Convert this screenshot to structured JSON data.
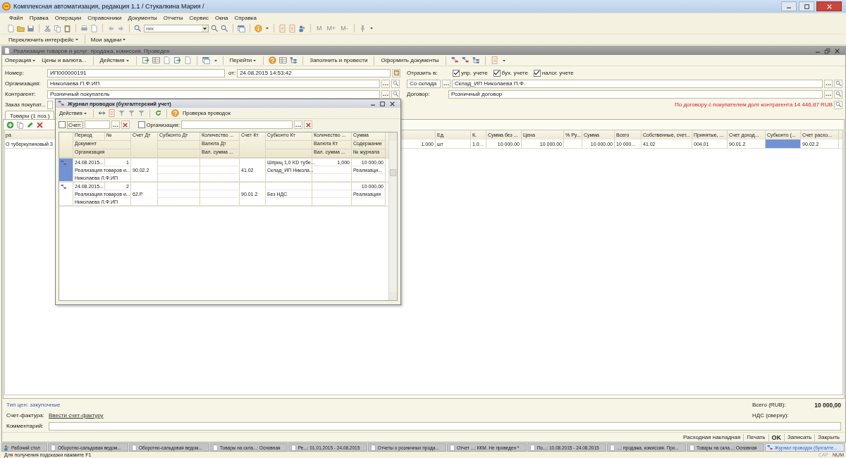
{
  "app_window": {
    "title": "Комплексная автоматизация, редакция 1.1 / Стукалкина Мария /"
  },
  "menu": [
    "Файл",
    "Правка",
    "Операции",
    "Справочники",
    "Документы",
    "Отчеты",
    "Сервис",
    "Окна",
    "Справка"
  ],
  "toolbar": {
    "search_value": "ник",
    "memory_buttons": [
      "M",
      "M+",
      "M-"
    ]
  },
  "panel": [
    {
      "label": "Переключить интерфейс",
      "dropdown": true
    },
    {
      "label": "Мои задачи",
      "dropdown": true
    }
  ],
  "document": {
    "title": "Реализация товаров и услуг: продажа, комиссия. Проведен",
    "toolbar": [
      {
        "label": "Операция",
        "dropdown": true
      },
      {
        "label": "Цены и валюта...",
        "dropdown": false
      },
      {
        "label": "Действия",
        "dropdown": true
      },
      {
        "label": "Перейти",
        "dropdown": true
      },
      {
        "label": "Заполнить и провести",
        "dropdown": false
      },
      {
        "label": "Оформить документы",
        "dropdown": false
      }
    ],
    "number": {
      "label": "Номер:",
      "value": "ИП000000191"
    },
    "date": {
      "label": "от:",
      "value": "24.08.2015 14:53:42"
    },
    "organization": {
      "label": "Организация:",
      "value": "Николаева П.Ф.ИП"
    },
    "counterparty": {
      "label": "Контрагент:",
      "value": "Розничный покупатель"
    },
    "customer_order": {
      "label": "Заказ покупат..."
    },
    "reflect": {
      "label": "Отразить в:",
      "options": [
        {
          "label": "упр. учете",
          "checked": true
        },
        {
          "label": "бух. учете",
          "checked": true
        },
        {
          "label": "налог. учете",
          "checked": true
        }
      ]
    },
    "warehouse": {
      "selector": "Со склада",
      "value": "Склад_ИП Николаева П.Ф."
    },
    "contract": {
      "label": "Договор:",
      "value": "Розничный договор"
    },
    "debt_notice": "По договору с покупателем долг контрагента 14 446,87 RUB",
    "tabs": [
      {
        "label": "Товары (1 поз.)",
        "selected": true
      }
    ],
    "goods_table": {
      "columns": [
        {
          "header": "ра",
          "cell": "О туберкулиновый З",
          "kind": "text",
          "selected": false
        },
        {
          "cell": "1.000",
          "kind": "number",
          "selected": false
        },
        {
          "header": "Ед.",
          "cell": "шт",
          "kind": "text",
          "selected": false
        },
        {
          "header": "К.",
          "cell": "1.0...",
          "kind": "text",
          "selected": false
        },
        {
          "header": "Сумма без ...",
          "cell": "10 000.00",
          "kind": "number",
          "selected": false
        },
        {
          "header": "Цена",
          "cell": "10 000.00",
          "kind": "number",
          "selected": false
        },
        {
          "header": "% Ру...",
          "kind": "number",
          "selected": false
        },
        {
          "header": "Сумма",
          "cell": "10 000.00",
          "kind": "number",
          "selected": false
        },
        {
          "header": "Всего",
          "cell": "10 000...",
          "kind": "text",
          "selected": false
        },
        {
          "header": "Собственные, счет...",
          "cell": "41.02",
          "kind": "text",
          "selected": false
        },
        {
          "header": "Принятые, ...",
          "cell": "004.01",
          "kind": "text",
          "selected": false
        },
        {
          "header": "Счет доход...",
          "cell": "90.01.2",
          "kind": "text",
          "selected": false
        },
        {
          "header": "Субконто (...",
          "kind": "text",
          "selected": true
        },
        {
          "header": "Счет расхо...",
          "cell": "90.02.2",
          "kind": "text",
          "selected": false
        }
      ]
    },
    "price_type": "Тип цен: закупочные",
    "invoice": {
      "label": "Счет-фактура:",
      "link": "Ввести счет-фактуру"
    },
    "total": {
      "label": "Всего (RUB):",
      "value": "10 000,00"
    },
    "vat": {
      "label": "НДС (сверху):"
    },
    "comment": {
      "label": "Комментарий:"
    },
    "actions": [
      {
        "label": "Расходная накладная",
        "default": false
      },
      {
        "label": "Печать",
        "default": false
      },
      {
        "label": "OK",
        "default": true
      },
      {
        "label": "Записать",
        "default": false
      },
      {
        "label": "Закрыть",
        "default": false
      }
    ]
  },
  "journal": {
    "title": "Журнал проводок (бухгалтерский учет)",
    "toolbar": {
      "actions": "Действия",
      "check": "Проверка проводок"
    },
    "filters": [
      {
        "label": "Счет:",
        "checked": false
      },
      {
        "label": "Организация:",
        "checked": false
      }
    ],
    "header_rows": [
      [
        "Период",
        "№",
        "Счет Дт",
        "Субконто Дт",
        "Количество ...",
        "Счет Кт",
        "Субконто Кт",
        "Количество ...",
        "Сумма"
      ],
      [
        "Документ",
        "Валюта Дт",
        "Валюта Кт",
        "Содержание"
      ],
      [
        "Организация",
        "Вал. сумма ...",
        "Вал. сумма ...",
        "№ журнала"
      ]
    ],
    "records": [
      {
        "selected": true,
        "period": "24.08.2015...",
        "number": "1",
        "document": "Реализация товаров и...",
        "organization": "Николаева Л.Ф.ИП",
        "account_dt": "90.02.2",
        "account_kt": "41.02",
        "subconto_kt": {
          "line_1": "Шприц 1,0 KD тубе...",
          "line_2": "Склад_ИП Никола..."
        },
        "quantity_kt": {
          "line_1": "1,000"
        },
        "sum": "10 000,00",
        "content": "Реализаци..."
      },
      {
        "selected": false,
        "period": "24.08.2015...",
        "number": "2",
        "document": "Реализация товаров и...",
        "organization": "Николаева Л.Ф.ИП",
        "account_dt": "62.Р",
        "account_kt": "90.01.2",
        "subconto_kt": {
          "line_2": "Без НДС"
        },
        "sum": "10 000,00",
        "content": "Реализация"
      }
    ]
  },
  "taskbar": [
    {
      "label": "Рабочий стол",
      "selected": false
    },
    {
      "label": "Оборотно-сальдовая ведом...",
      "selected": false
    },
    {
      "label": "Оборотно-сальдовая ведом...",
      "selected": false
    },
    {
      "label": "Товары на скла...: Основная",
      "selected": false
    },
    {
      "label": "Ре...: 01.01.2015 - 24.08.2015",
      "selected": false
    },
    {
      "label": "Отчеты о розничных прода...",
      "selected": false
    },
    {
      "label": "Отчет ...: ККМ. Не проведен *",
      "selected": false
    },
    {
      "label": "По...: 10.08.2015 - 24.08.2015",
      "selected": false
    },
    {
      "label": "...: продажа, комиссия. Про...",
      "selected": false
    },
    {
      "label": "Товары на скла...: Основная",
      "selected": false
    },
    {
      "label": "Журнал проводок (бухгалте...",
      "selected": true
    }
  ],
  "status_bar": {
    "hint": "Для получения подсказки нажмите F1",
    "indicators": [
      {
        "label": "CAP",
        "on": false
      },
      {
        "label": "NUM",
        "on": true
      }
    ]
  }
}
